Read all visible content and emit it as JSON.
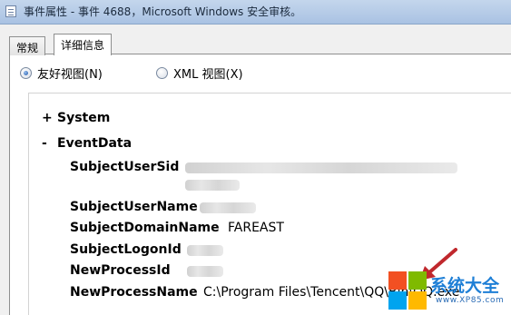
{
  "window": {
    "title": "事件属性 - 事件 4688，Microsoft Windows 安全审核。"
  },
  "tabs": [
    {
      "label": "常规"
    },
    {
      "label": "详细信息"
    }
  ],
  "view_options": {
    "friendly": "友好视图(N)",
    "xml": "XML 视图(X)",
    "selected": "friendly"
  },
  "tree": {
    "system": {
      "toggle": "+",
      "label": "System"
    },
    "eventdata": {
      "toggle": "-",
      "label": "EventData"
    }
  },
  "fields": [
    {
      "name": "SubjectUserSid",
      "value": ""
    },
    {
      "name": "SubjectUserName",
      "value": ""
    },
    {
      "name": "SubjectDomainName",
      "value": "FAREAST"
    },
    {
      "name": "SubjectLogonId",
      "value": ""
    },
    {
      "name": "NewProcessId",
      "value": ""
    },
    {
      "name": "NewProcessName",
      "value": "C:\\Program Files\\Tencent\\QQ\\Bin\\QQ.exe"
    }
  ],
  "watermark": {
    "brand": "系统大全",
    "url": "www.XP85.com",
    "colors": {
      "red": "#f25022",
      "green": "#7fba00",
      "blue": "#00a4ef",
      "yellow": "#ffb900",
      "arrow": "#c0282d"
    }
  }
}
